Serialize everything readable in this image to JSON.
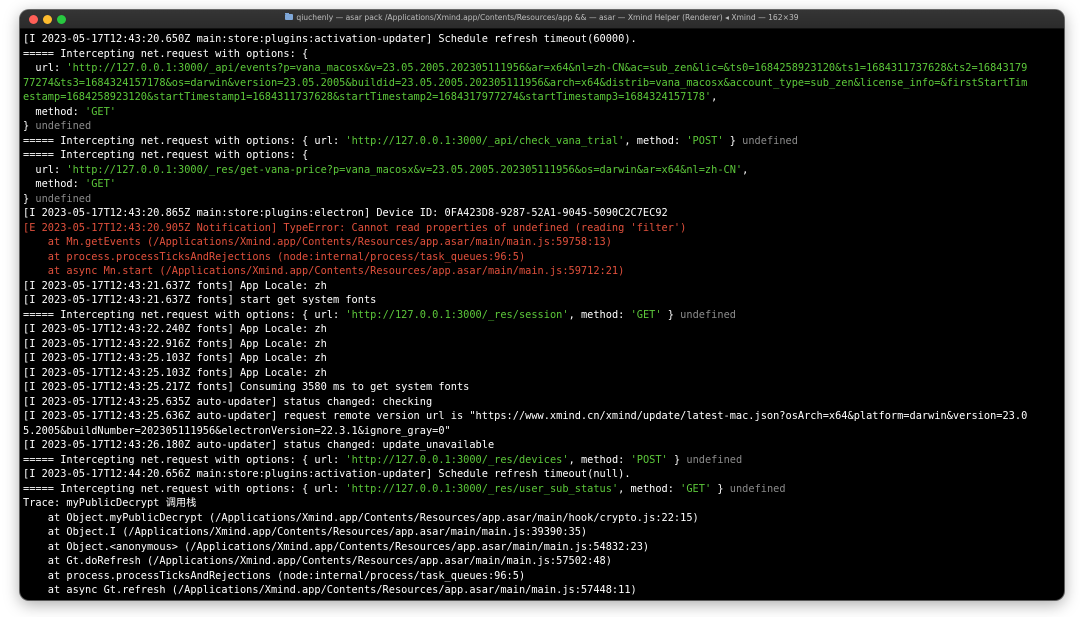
{
  "window": {
    "title": "qiuchenly — asar pack /Applications/Xmind.app/Contents/Resources/app  &&  — asar — Xmind Helper (Renderer) ◂ Xmind — 162×39"
  },
  "colors": {
    "background": "#000000",
    "text": "#ffffff",
    "string": "#5cc83a",
    "undefined": "#8a8a8a",
    "error": "#e0503c"
  },
  "lines": [
    {
      "segments": [
        {
          "t": "[I 2023-05-17T12:43:20.650Z main:store:plugins:activation-updater] Schedule refresh timeout(60000).",
          "c": "white"
        }
      ]
    },
    {
      "segments": [
        {
          "t": "===== Intercepting net.request with options: {",
          "c": "white"
        }
      ]
    },
    {
      "segments": [
        {
          "t": "  url: ",
          "c": "white"
        },
        {
          "t": "'http://127.0.0.1:3000/_api/events?p=vana_macosx&v=23.05.2005.202305111956&ar=x64&nl=zh-CN&ac=sub_zen&lic=&ts0=1684258923120&ts1=1684311737628&ts2=16843179",
          "c": "green"
        }
      ]
    },
    {
      "segments": [
        {
          "t": "77274&ts3=1684324157178&os=darwin&version=23.05.2005&buildid=23.05.2005.202305111956&arch=x64&distrib=vana_macosx&account_type=sub_zen&license_info=&firstStartTim",
          "c": "green"
        }
      ]
    },
    {
      "segments": [
        {
          "t": "estamp=1684258923120&startTimestamp1=1684311737628&startTimestamp2=1684317977274&startTimestamp3=1684324157178'",
          "c": "green"
        },
        {
          "t": ",",
          "c": "white"
        }
      ]
    },
    {
      "segments": [
        {
          "t": "  method: ",
          "c": "white"
        },
        {
          "t": "'GET'",
          "c": "green"
        }
      ]
    },
    {
      "segments": [
        {
          "t": "} ",
          "c": "white"
        },
        {
          "t": "undefined",
          "c": "gray"
        }
      ]
    },
    {
      "segments": [
        {
          "t": "===== Intercepting net.request with options: { url: ",
          "c": "white"
        },
        {
          "t": "'http://127.0.0.1:3000/_api/check_vana_trial'",
          "c": "green"
        },
        {
          "t": ", method: ",
          "c": "white"
        },
        {
          "t": "'POST'",
          "c": "green"
        },
        {
          "t": " } ",
          "c": "white"
        },
        {
          "t": "undefined",
          "c": "gray"
        }
      ]
    },
    {
      "segments": [
        {
          "t": "===== Intercepting net.request with options: {",
          "c": "white"
        }
      ]
    },
    {
      "segments": [
        {
          "t": "  url: ",
          "c": "white"
        },
        {
          "t": "'http://127.0.0.1:3000/_res/get-vana-price?p=vana_macosx&v=23.05.2005.202305111956&os=darwin&ar=x64&nl=zh-CN'",
          "c": "green"
        },
        {
          "t": ",",
          "c": "white"
        }
      ]
    },
    {
      "segments": [
        {
          "t": "  method: ",
          "c": "white"
        },
        {
          "t": "'GET'",
          "c": "green"
        }
      ]
    },
    {
      "segments": [
        {
          "t": "} ",
          "c": "white"
        },
        {
          "t": "undefined",
          "c": "gray"
        }
      ]
    },
    {
      "segments": [
        {
          "t": "[I 2023-05-17T12:43:20.865Z main:store:plugins:electron] Device ID: 0FA423D8-9287-52A1-9045-5090C2C7EC92",
          "c": "white"
        }
      ]
    },
    {
      "segments": [
        {
          "t": "[E 2023-05-17T12:43:20.905Z Notification] TypeError: Cannot read properties of undefined (reading 'filter')",
          "c": "red"
        }
      ]
    },
    {
      "segments": [
        {
          "t": "    at Mn.getEvents (/Applications/Xmind.app/Contents/Resources/app.asar/main/main.js:59758:13)",
          "c": "red"
        }
      ]
    },
    {
      "segments": [
        {
          "t": "    at process.processTicksAndRejections (node:internal/process/task_queues:96:5)",
          "c": "red"
        }
      ]
    },
    {
      "segments": [
        {
          "t": "    at async Mn.start (/Applications/Xmind.app/Contents/Resources/app.asar/main/main.js:59712:21)",
          "c": "red"
        }
      ]
    },
    {
      "segments": [
        {
          "t": "[I 2023-05-17T12:43:21.637Z fonts] App Locale: zh",
          "c": "white"
        }
      ]
    },
    {
      "segments": [
        {
          "t": "[I 2023-05-17T12:43:21.637Z fonts] start get system fonts",
          "c": "white"
        }
      ]
    },
    {
      "segments": [
        {
          "t": "===== Intercepting net.request with options: { url: ",
          "c": "white"
        },
        {
          "t": "'http://127.0.0.1:3000/_res/session'",
          "c": "green"
        },
        {
          "t": ", method: ",
          "c": "white"
        },
        {
          "t": "'GET'",
          "c": "green"
        },
        {
          "t": " } ",
          "c": "white"
        },
        {
          "t": "undefined",
          "c": "gray"
        }
      ]
    },
    {
      "segments": [
        {
          "t": "[I 2023-05-17T12:43:22.240Z fonts] App Locale: zh",
          "c": "white"
        }
      ]
    },
    {
      "segments": [
        {
          "t": "[I 2023-05-17T12:43:22.916Z fonts] App Locale: zh",
          "c": "white"
        }
      ]
    },
    {
      "segments": [
        {
          "t": "[I 2023-05-17T12:43:25.103Z fonts] App Locale: zh",
          "c": "white"
        }
      ]
    },
    {
      "segments": [
        {
          "t": "[I 2023-05-17T12:43:25.103Z fonts] App Locale: zh",
          "c": "white"
        }
      ]
    },
    {
      "segments": [
        {
          "t": "[I 2023-05-17T12:43:25.217Z fonts] Consuming 3580 ms to get system fonts",
          "c": "white"
        }
      ]
    },
    {
      "segments": [
        {
          "t": "[I 2023-05-17T12:43:25.635Z auto-updater] status changed: checking",
          "c": "white"
        }
      ]
    },
    {
      "segments": [
        {
          "t": "[I 2023-05-17T12:43:25.636Z auto-updater] request remote version url is \"https://www.xmind.cn/xmind/update/latest-mac.json?osArch=x64&platform=darwin&version=23.0",
          "c": "white"
        }
      ]
    },
    {
      "segments": [
        {
          "t": "5.2005&buildNumber=202305111956&electronVersion=22.3.1&ignore_gray=0\"",
          "c": "white"
        }
      ]
    },
    {
      "segments": [
        {
          "t": "[I 2023-05-17T12:43:26.180Z auto-updater] status changed: update_unavailable",
          "c": "white"
        }
      ]
    },
    {
      "segments": [
        {
          "t": "===== Intercepting net.request with options: { url: ",
          "c": "white"
        },
        {
          "t": "'http://127.0.0.1:3000/_res/devices'",
          "c": "green"
        },
        {
          "t": ", method: ",
          "c": "white"
        },
        {
          "t": "'POST'",
          "c": "green"
        },
        {
          "t": " } ",
          "c": "white"
        },
        {
          "t": "undefined",
          "c": "gray"
        }
      ]
    },
    {
      "segments": [
        {
          "t": "[I 2023-05-17T12:44:20.656Z main:store:plugins:activation-updater] Schedule refresh timeout(null).",
          "c": "white"
        }
      ]
    },
    {
      "segments": [
        {
          "t": "===== Intercepting net.request with options: { url: ",
          "c": "white"
        },
        {
          "t": "'http://127.0.0.1:3000/_res/user_sub_status'",
          "c": "green"
        },
        {
          "t": ", method: ",
          "c": "white"
        },
        {
          "t": "'GET'",
          "c": "green"
        },
        {
          "t": " } ",
          "c": "white"
        },
        {
          "t": "undefined",
          "c": "gray"
        }
      ]
    },
    {
      "segments": [
        {
          "t": "Trace: myPublicDecrypt 调用栈",
          "c": "white"
        }
      ]
    },
    {
      "segments": [
        {
          "t": "    at Object.myPublicDecrypt (/Applications/Xmind.app/Contents/Resources/app.asar/main/hook/crypto.js:22:15)",
          "c": "white"
        }
      ]
    },
    {
      "segments": [
        {
          "t": "    at Object.I (/Applications/Xmind.app/Contents/Resources/app.asar/main/main.js:39390:35)",
          "c": "white"
        }
      ]
    },
    {
      "segments": [
        {
          "t": "    at Object.<anonymous> (/Applications/Xmind.app/Contents/Resources/app.asar/main/main.js:54832:23)",
          "c": "white"
        }
      ]
    },
    {
      "segments": [
        {
          "t": "    at Gt.doRefresh (/Applications/Xmind.app/Contents/Resources/app.asar/main/main.js:57502:48)",
          "c": "white"
        }
      ]
    },
    {
      "segments": [
        {
          "t": "    at process.processTicksAndRejections (node:internal/process/task_queues:96:5)",
          "c": "white"
        }
      ]
    },
    {
      "segments": [
        {
          "t": "    at async Gt.refresh (/Applications/Xmind.app/Contents/Resources/app.asar/main/main.js:57448:11)",
          "c": "white"
        }
      ]
    }
  ]
}
